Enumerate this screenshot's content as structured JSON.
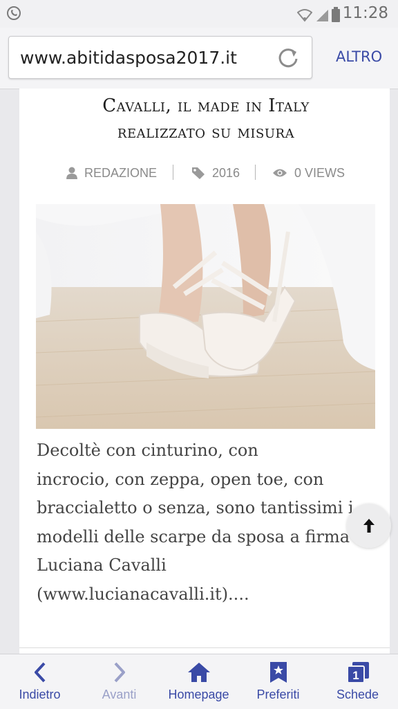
{
  "status_bar": {
    "time": "11:28"
  },
  "browser": {
    "url": "www.abitidasposa2017.it",
    "more_label": "ALTRO"
  },
  "article": {
    "title_line1": "Cavalli, il made in Italy",
    "title_line2": "realizzato su misura",
    "author": "REDAZIONE",
    "tag": "2016",
    "views": "0 VIEWS",
    "body": [
      "Decoltè con cinturino, con",
      "incrocio, con zeppa, open toe, con",
      "braccialetto o senza, sono tantissimi i",
      "modelli delle scarpe da sposa a firma",
      "Luciana Cavalli",
      "(www.lucianacavalli.it)...."
    ]
  },
  "bottom_nav": {
    "items": [
      {
        "label": "Indietro",
        "icon": "chevron-left-icon",
        "enabled": true
      },
      {
        "label": "Avanti",
        "icon": "chevron-right-icon",
        "enabled": false
      },
      {
        "label": "Homepage",
        "icon": "home-icon",
        "enabled": true
      },
      {
        "label": "Preferiti",
        "icon": "bookmark-star-icon",
        "enabled": true
      },
      {
        "label": "Schede",
        "icon": "tabs-icon",
        "badge": "1",
        "enabled": true
      }
    ]
  },
  "colors": {
    "accent": "#3a4aa6",
    "disabled": "#9aa0c8",
    "text": "#444444"
  }
}
